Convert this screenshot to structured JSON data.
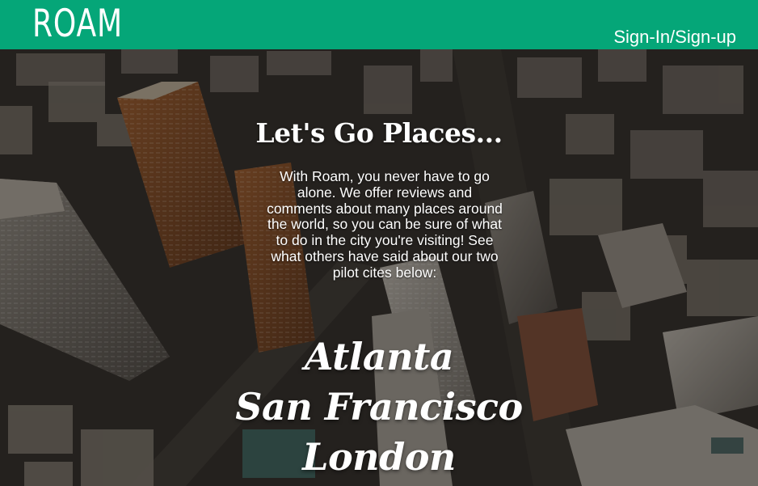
{
  "header": {
    "logo_text": "ROAM",
    "auth_link_label": "Sign-In/Sign-up",
    "bar_color": "#05a678"
  },
  "hero": {
    "background_description_icon": "city-aerial-photo",
    "headline": "Let's Go Places...",
    "intro_text": "With Roam, you never have to go alone. We offer reviews and comments about many places around the world, so you can be sure of what to do in the city you're visiting! See what others have said about our two pilot cites below:",
    "cities": [
      {
        "label": "Atlanta"
      },
      {
        "label": "San Francisco"
      },
      {
        "label": "London"
      }
    ]
  }
}
